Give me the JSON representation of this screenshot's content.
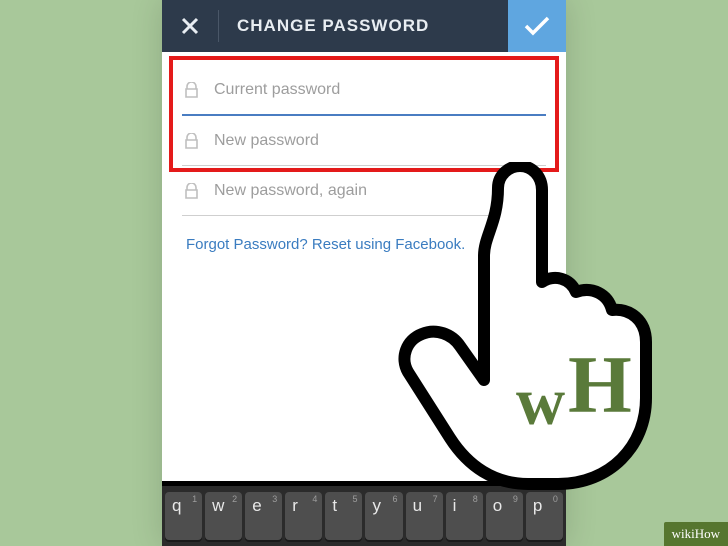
{
  "header": {
    "title": "CHANGE PASSWORD"
  },
  "fields": {
    "current": "Current password",
    "new": "New password",
    "again": "New password, again"
  },
  "forgot": "Forgot Password? Reset using Facebook.",
  "keyboard": {
    "row": [
      "q",
      "w",
      "e",
      "r",
      "t",
      "y",
      "u",
      "i",
      "o",
      "p"
    ],
    "nums": [
      "1",
      "2",
      "3",
      "4",
      "5",
      "6",
      "7",
      "8",
      "9",
      "0"
    ]
  },
  "hand_letters": {
    "w": "w",
    "h": "H"
  },
  "brand": "wikiHow"
}
